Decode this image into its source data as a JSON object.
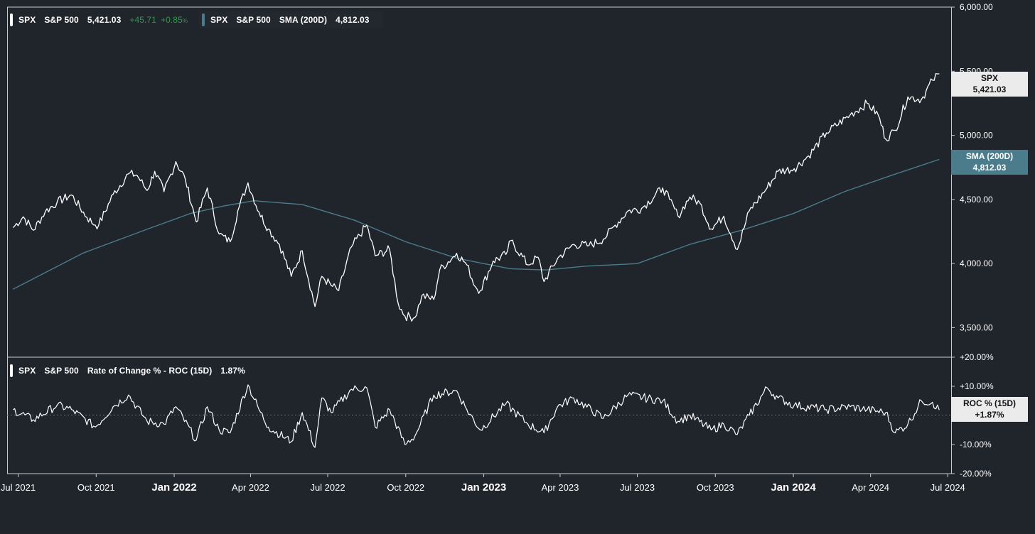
{
  "main_legend": {
    "ticker": "SPX",
    "name": "S&P 500",
    "price": "5,421.03",
    "change": "+45.71",
    "change_pct": "+0.85",
    "pct_sign": "%"
  },
  "sma_legend": {
    "ticker": "SPX",
    "name": "S&P 500",
    "indicator": "SMA (200D)",
    "value": "4,812.03"
  },
  "roc_legend": {
    "ticker": "SPX",
    "name": "S&P 500",
    "indicator": "Rate of Change % - ROC (15D)",
    "value": "1.87%"
  },
  "tags": {
    "spx_title": "SPX",
    "spx_value": "5,421.03",
    "sma_title": "SMA (200D)",
    "sma_value": "4,812.03",
    "roc_title": "ROC % (15D)",
    "roc_value": "+1.87%"
  },
  "colors": {
    "background": "#20242b",
    "price_line": "#ffffff",
    "sma_line": "#4b7c8c",
    "positive": "#2e9a4a",
    "axis_text": "#ffffff"
  },
  "chart_data": [
    {
      "type": "line",
      "title": "",
      "x_tick_labels": [
        "Jul 2021",
        "Oct 2021",
        "Jan 2022",
        "Apr 2022",
        "Jul 2022",
        "Oct 2022",
        "Jan 2023",
        "Apr 2023",
        "Jul 2023",
        "Oct 2023",
        "Jan 2024",
        "Apr 2024",
        "Jul 2024"
      ],
      "x_tick_bold": [
        "Jan 2022",
        "Jan 2023",
        "Jan 2024"
      ],
      "y_tick_labels": [
        "3,500.00",
        "4,000.00",
        "4,500.00",
        "5,000.00",
        "5,500.00",
        "6,000.00"
      ],
      "ylim": [
        3270,
        6000
      ],
      "grid": false,
      "series": [
        {
          "name": "SPX",
          "x": [
            "2021-06-25",
            "2021-07-07",
            "2021-07-19",
            "2021-08-02",
            "2021-08-16",
            "2021-09-02",
            "2021-09-20",
            "2021-09-30",
            "2021-10-04",
            "2021-10-21",
            "2021-11-08",
            "2021-11-18",
            "2021-11-30",
            "2021-12-09",
            "2021-12-20",
            "2022-01-03",
            "2022-01-14",
            "2022-01-27",
            "2022-02-09",
            "2022-02-23",
            "2022-03-08",
            "2022-03-17",
            "2022-03-29",
            "2022-04-11",
            "2022-04-22",
            "2022-05-05",
            "2022-05-19",
            "2022-06-01",
            "2022-06-16",
            "2022-06-24",
            "2022-07-05",
            "2022-07-14",
            "2022-07-29",
            "2022-08-16",
            "2022-08-26",
            "2022-09-12",
            "2022-09-22",
            "2022-09-30",
            "2022-10-12",
            "2022-10-20",
            "2022-11-03",
            "2022-11-10",
            "2022-11-30",
            "2022-12-12",
            "2022-12-22",
            "2022-12-28",
            "2023-01-12",
            "2023-01-27",
            "2023-02-02",
            "2023-02-22",
            "2023-03-06",
            "2023-03-13",
            "2023-03-29",
            "2023-04-17",
            "2023-05-05",
            "2023-05-22",
            "2023-06-05",
            "2023-06-20",
            "2023-07-06",
            "2023-07-31",
            "2023-08-08",
            "2023-08-18",
            "2023-09-01",
            "2023-09-13",
            "2023-09-26",
            "2023-10-11",
            "2023-10-27",
            "2023-11-10",
            "2023-12-01",
            "2023-12-14",
            "2024-01-02",
            "2024-01-19",
            "2024-02-09",
            "2024-03-08",
            "2024-03-28",
            "2024-04-10",
            "2024-04-19",
            "2024-04-30",
            "2024-05-15",
            "2024-05-31",
            "2024-06-13",
            "2024-06-21"
          ],
          "values": [
            4280,
            4365,
            4260,
            4405,
            4480,
            4535,
            4360,
            4300,
            4300,
            4540,
            4700,
            4690,
            4570,
            4720,
            4560,
            4795,
            4660,
            4325,
            4590,
            4230,
            4170,
            4410,
            4630,
            4400,
            4270,
            4150,
            3900,
            4100,
            3665,
            3900,
            3830,
            3790,
            4130,
            4300,
            4060,
            4110,
            3690,
            3590,
            3580,
            3750,
            3720,
            3950,
            4080,
            3990,
            3820,
            3790,
            4020,
            4070,
            4180,
            3990,
            4050,
            3860,
            4040,
            4150,
            4140,
            4190,
            4300,
            4410,
            4430,
            4590,
            4500,
            4370,
            4520,
            4470,
            4270,
            4370,
            4110,
            4410,
            4590,
            4720,
            4740,
            4840,
            5020,
            5160,
            5250,
            5160,
            4970,
            5040,
            5300,
            5280,
            5430,
            5480
          ]
        },
        {
          "name": "SMA (200D)",
          "x": [
            "2021-06-25",
            "2021-09-15",
            "2021-12-01",
            "2022-01-20",
            "2022-03-01",
            "2022-04-05",
            "2022-06-01",
            "2022-08-01",
            "2022-10-01",
            "2022-12-01",
            "2023-02-01",
            "2023-03-15",
            "2023-05-01",
            "2023-07-01",
            "2023-09-01",
            "2023-11-01",
            "2024-01-01",
            "2024-03-01",
            "2024-05-01",
            "2024-06-21"
          ],
          "values": [
            3800,
            4080,
            4270,
            4390,
            4450,
            4490,
            4460,
            4340,
            4170,
            4040,
            3960,
            3950,
            3980,
            4000,
            4150,
            4260,
            4390,
            4560,
            4700,
            4812
          ]
        }
      ]
    },
    {
      "type": "line",
      "title": "",
      "y_tick_labels": [
        "-20.00%",
        "-10.00%",
        "+10.00%",
        "+20.00%"
      ],
      "ylim": [
        -20,
        20
      ],
      "grid": false,
      "series": [
        {
          "name": "Rate of Change % - ROC (15D)",
          "x": [
            "2021-06-25",
            "2021-07-19",
            "2021-08-16",
            "2021-09-02",
            "2021-09-30",
            "2021-10-21",
            "2021-11-08",
            "2021-11-30",
            "2021-12-20",
            "2022-01-03",
            "2022-01-27",
            "2022-02-09",
            "2022-02-23",
            "2022-03-08",
            "2022-03-29",
            "2022-04-11",
            "2022-04-22",
            "2022-05-19",
            "2022-06-01",
            "2022-06-16",
            "2022-06-24",
            "2022-07-05",
            "2022-07-29",
            "2022-08-16",
            "2022-08-26",
            "2022-09-12",
            "2022-09-30",
            "2022-10-12",
            "2022-11-03",
            "2022-11-30",
            "2022-12-12",
            "2022-12-28",
            "2023-01-27",
            "2023-02-22",
            "2023-03-13",
            "2023-03-29",
            "2023-04-17",
            "2023-05-22",
            "2023-06-20",
            "2023-07-31",
            "2023-08-18",
            "2023-09-01",
            "2023-09-26",
            "2023-10-11",
            "2023-10-27",
            "2023-11-10",
            "2023-12-01",
            "2023-12-14",
            "2024-01-02",
            "2024-02-09",
            "2024-03-08",
            "2024-03-28",
            "2024-04-19",
            "2024-04-30",
            "2024-05-15",
            "2024-05-31",
            "2024-06-13",
            "2024-06-21"
          ],
          "values": [
            2.0,
            -1.5,
            3.5,
            2.0,
            -4.0,
            3.0,
            7.0,
            -2.0,
            -3.0,
            3.0,
            -8.5,
            3.0,
            -5.0,
            -6.0,
            10.5,
            2.0,
            -4.0,
            -9.0,
            1.0,
            -11.0,
            6.0,
            1.0,
            9.0,
            9.5,
            -4.0,
            2.0,
            -10.0,
            -7.0,
            7.0,
            8.5,
            2.0,
            -5.0,
            4.0,
            -3.0,
            -6.0,
            3.0,
            6.0,
            -1.0,
            7.0,
            5.0,
            -2.0,
            0.0,
            -5.0,
            -3.0,
            -6.5,
            0.0,
            9.5,
            6.0,
            3.5,
            2.0,
            3.0,
            2.0,
            1.0,
            -6.0,
            -3.0,
            5.0,
            4.5,
            1.87
          ]
        }
      ]
    }
  ]
}
